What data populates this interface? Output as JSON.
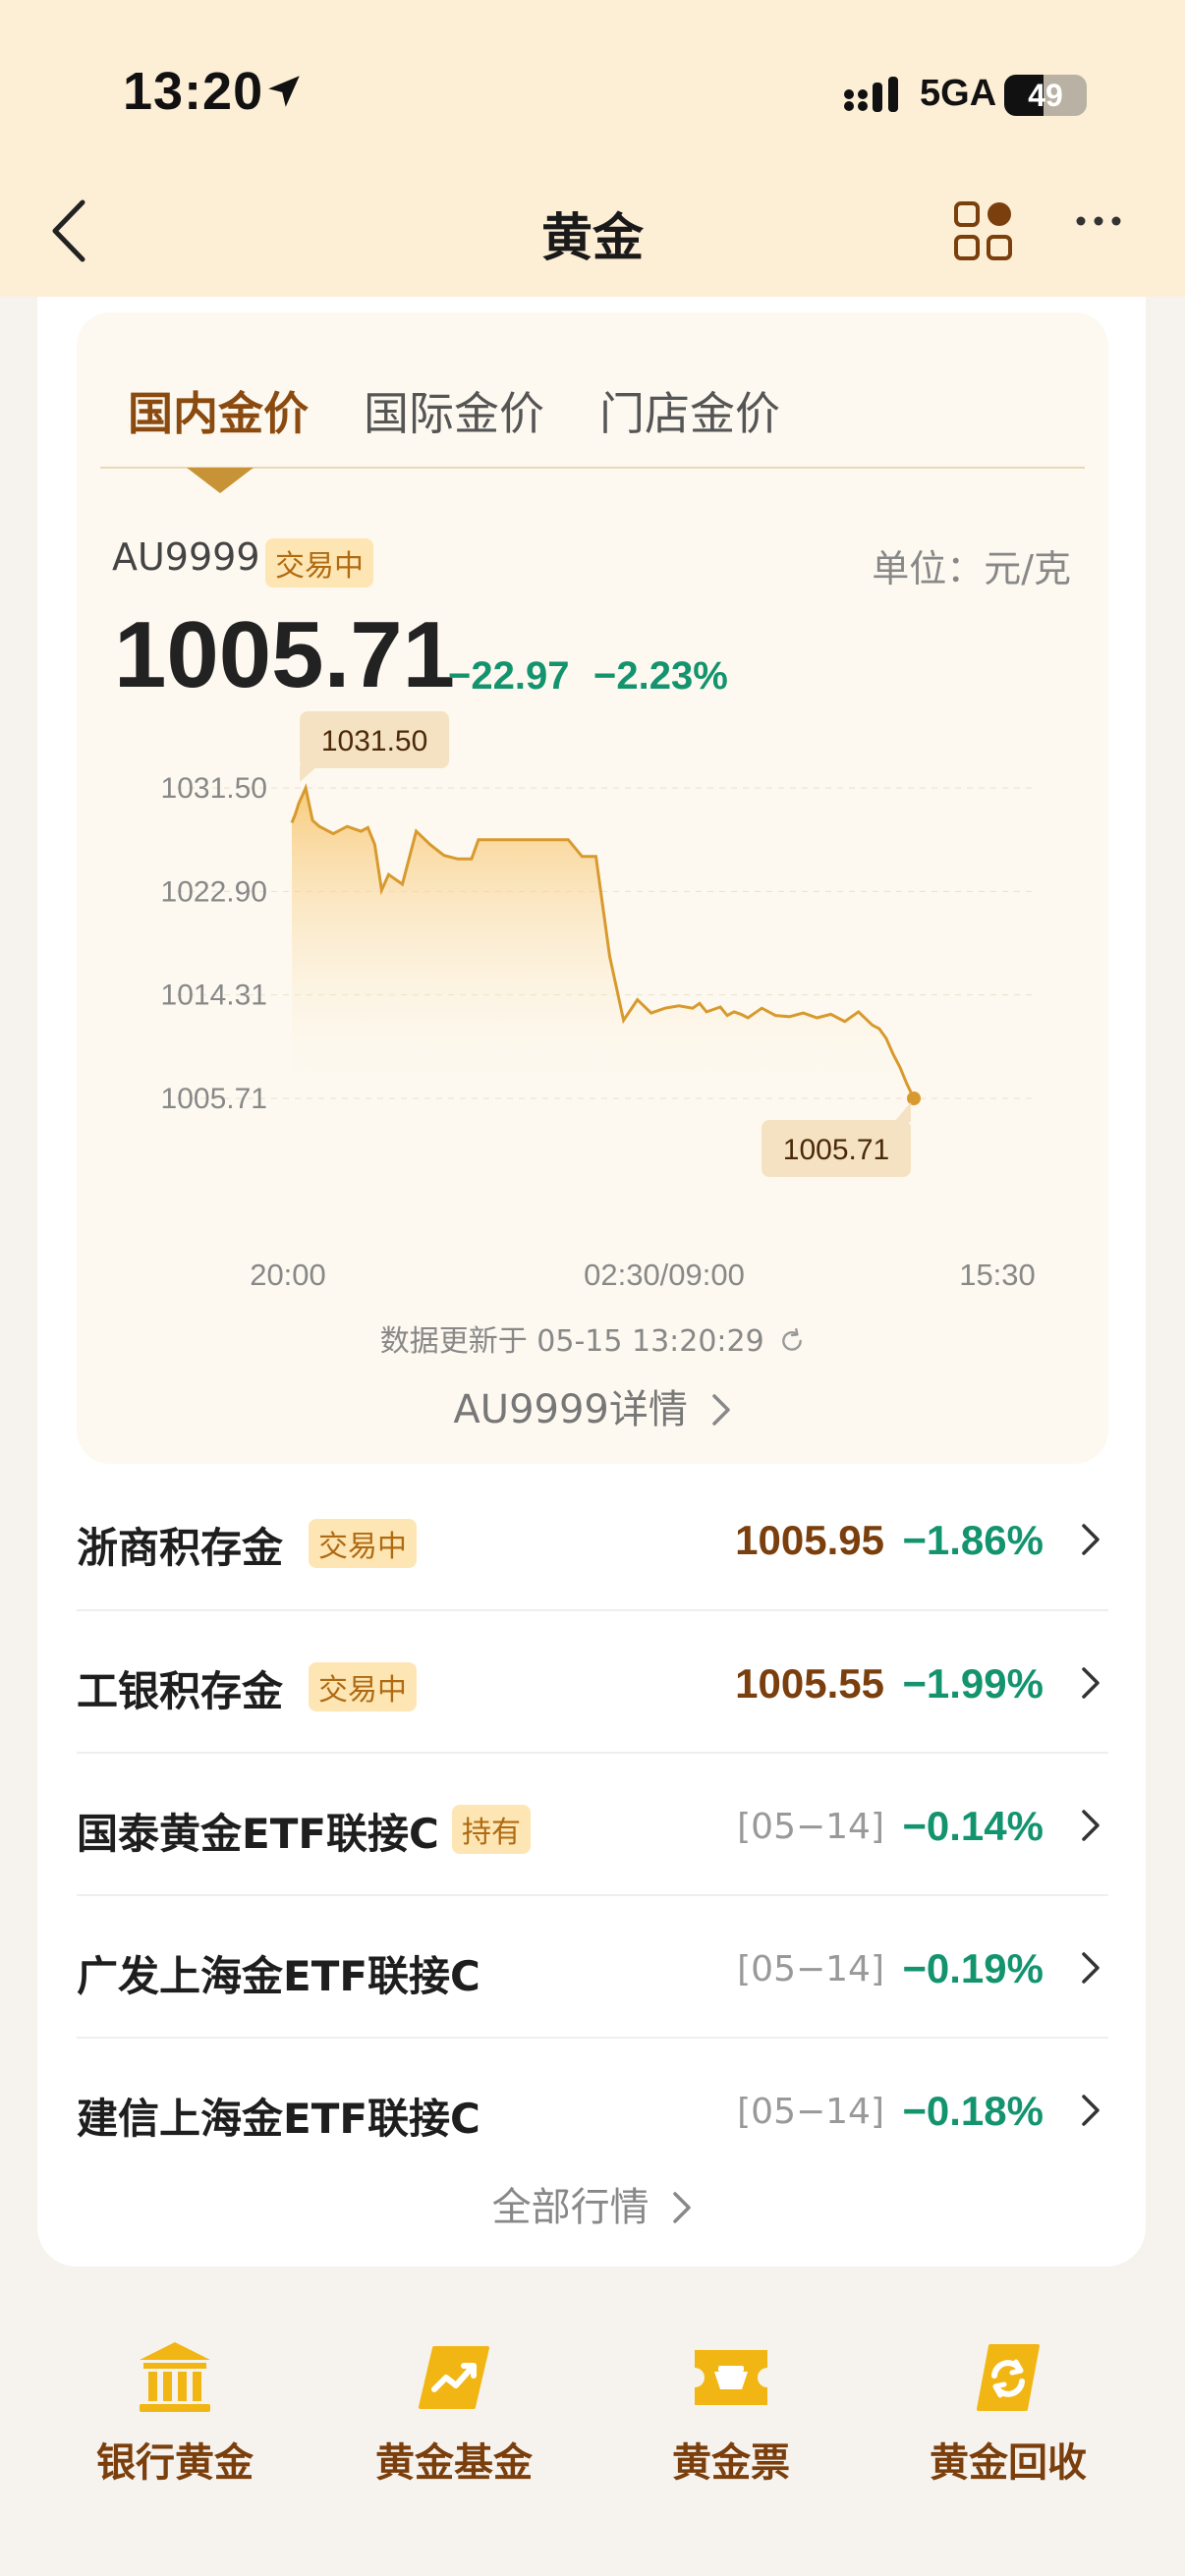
{
  "status_bar": {
    "time": "13:20",
    "network": "5GA",
    "battery": "49",
    "battery_level_percent": 49
  },
  "nav": {
    "title": "黄金",
    "icons": [
      "back-icon",
      "grid-apps-icon",
      "more-icon"
    ]
  },
  "price_card": {
    "tabs": [
      {
        "label": "国内金价",
        "active": true
      },
      {
        "label": "国际金价",
        "active": false
      },
      {
        "label": "门店金价",
        "active": false
      }
    ],
    "symbol": "AU9999",
    "status_badge": "交易中",
    "unit": "单位：元/克",
    "price": "1005.71",
    "change": "−22.97",
    "change_pct": "−2.23%",
    "update_text": "数据更新于 05-15 13:20:29",
    "detail_link": "AU9999详情"
  },
  "chart_data": {
    "type": "line",
    "title": "",
    "xlabel": "",
    "ylabel": "",
    "x_ticks": [
      "20:00",
      "02:30/09:00",
      "15:30"
    ],
    "y_ticks": [
      "1031.50",
      "1022.90",
      "1014.31",
      "1005.71"
    ],
    "ylim": [
      1005.71,
      1031.5
    ],
    "grid": true,
    "max_label": "1031.50",
    "min_label": "1005.71",
    "series": [
      {
        "x": [
          0,
          0.5,
          1,
          2,
          3,
          4,
          6,
          8,
          10,
          11,
          12,
          13,
          14,
          16,
          18,
          20,
          22,
          24,
          26,
          27,
          28,
          29,
          30,
          31,
          32,
          33,
          34,
          36,
          38,
          40,
          42,
          44,
          46,
          48,
          50,
          52,
          54,
          56,
          58,
          59,
          60,
          61,
          62,
          63,
          64,
          65,
          66,
          68,
          70,
          72,
          74,
          76,
          78,
          80,
          82,
          84,
          85,
          86,
          87,
          88,
          89,
          90
        ],
        "y": [
          1028.6,
          1029.3,
          1030.2,
          1031.5,
          1028.8,
          1028.3,
          1027.7,
          1028.3,
          1027.9,
          1028.2,
          1026.8,
          1023.0,
          1024.3,
          1023.5,
          1027.9,
          1026.8,
          1025.9,
          1025.6,
          1025.6,
          1027.2,
          1027.2,
          1027.2,
          1027.2,
          1027.2,
          1027.2,
          1027.2,
          1027.2,
          1027.2,
          1027.2,
          1027.2,
          1025.8,
          1025.8,
          1017.5,
          1012.2,
          1013.9,
          1012.8,
          1013.2,
          1013.4,
          1013.2,
          1013.6,
          1012.9,
          1013.1,
          1013.3,
          1012.6,
          1012.9,
          1012.7,
          1012.4,
          1013.2,
          1012.6,
          1012.5,
          1012.8,
          1012.4,
          1012.7,
          1012.1,
          1012.9,
          1011.8,
          1011.5,
          1010.7,
          1009.4,
          1008.3,
          1006.9,
          1005.71
        ]
      }
    ]
  },
  "list": [
    {
      "name": "浙商积存金",
      "tag": "交易中",
      "value": "1005.95",
      "pct": "−1.86%"
    },
    {
      "name": "工银积存金",
      "tag": "交易中",
      "value": "1005.55",
      "pct": "−1.99%"
    },
    {
      "name": "国泰黄金ETF联接C",
      "tag": "持有",
      "date": "[05−14]",
      "pct": "−0.14%"
    },
    {
      "name": "广发上海金ETF联接C",
      "date": "[05−14]",
      "pct": "−0.19%"
    },
    {
      "name": "建信上海金ETF联接C",
      "date": "[05−14]",
      "pct": "−0.18%"
    }
  ],
  "all_link": "全部行情",
  "quick_nav": [
    {
      "label": "银行黄金",
      "icon": "bank-icon"
    },
    {
      "label": "黄金基金",
      "icon": "trend-chart-icon"
    },
    {
      "label": "黄金票",
      "icon": "ticket-icon"
    },
    {
      "label": "黄金回收",
      "icon": "recycle-icon"
    }
  ],
  "colors": {
    "header_bg": "#fdeed6",
    "accent_brown": "#8a4a10",
    "gold": "#c79336",
    "down_green": "#13946e",
    "badge_bg": "#fde6b3"
  }
}
